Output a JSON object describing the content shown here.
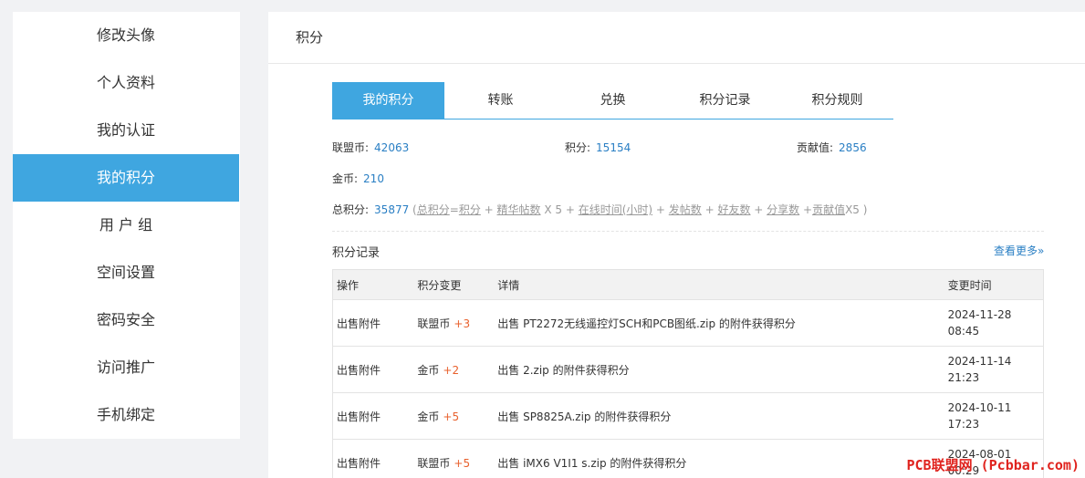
{
  "sidebar": {
    "items": [
      {
        "label": "修改头像"
      },
      {
        "label": "个人资料"
      },
      {
        "label": "我的认证"
      },
      {
        "label": "我的积分"
      },
      {
        "label": "用 户 组"
      },
      {
        "label": "空间设置"
      },
      {
        "label": "密码安全"
      },
      {
        "label": "访问推广"
      },
      {
        "label": "手机绑定"
      }
    ]
  },
  "header": {
    "title": "积分"
  },
  "tabs": [
    {
      "label": "我的积分"
    },
    {
      "label": "转账"
    },
    {
      "label": "兑换"
    },
    {
      "label": "积分记录"
    },
    {
      "label": "积分规则"
    }
  ],
  "stats": {
    "lianmengbi_label": "联盟币:",
    "lianmengbi_value": "42063",
    "jifen_label": "积分:",
    "jifen_value": "15154",
    "gongxian_label": "贡献值:",
    "gongxian_value": "2856",
    "jinbi_label": "金币:",
    "jinbi_value": "210"
  },
  "formula": {
    "label": "总积分:",
    "value": "35877",
    "open": " (",
    "total_link": "总积分",
    "eq": "=",
    "jifen_link": "积分",
    "plus1": " + ",
    "jinghua_link": "精华帖数",
    "x5": " X 5 + ",
    "online_link": "在线时间(小时)",
    "plus2": " + ",
    "fatie_link": "发帖数",
    "plus3": " + ",
    "haoyou_link": "好友数",
    "plus4": " + ",
    "fenxiang_link": "分享数",
    "plus5": " +",
    "gongxian_link": "贡献值",
    "tail": "X5 )"
  },
  "records": {
    "title": "积分记录",
    "more": "查看更多»",
    "headers": [
      "操作",
      "积分变更",
      "详情",
      "变更时间"
    ],
    "rows": [
      {
        "action": "出售附件",
        "currency": "联盟币",
        "delta": "+3",
        "detail": "出售 PT2272无线遥控灯SCH和PCB图纸.zip 的附件获得积分",
        "date": "2024-11-28",
        "time": "08:45"
      },
      {
        "action": "出售附件",
        "currency": "金币",
        "delta": "+2",
        "detail": "出售 2.zip 的附件获得积分",
        "date": "2024-11-14",
        "time": "21:23"
      },
      {
        "action": "出售附件",
        "currency": "金币",
        "delta": "+5",
        "detail": "出售 SP8825A.zip 的附件获得积分",
        "date": "2024-10-11",
        "time": "17:23"
      },
      {
        "action": "出售附件",
        "currency": "联盟币",
        "delta": "+5",
        "detail": "出售 iMX6 V1I1 s.zip 的附件获得积分",
        "date": "2024-08-01",
        "time": "00:29"
      }
    ]
  },
  "watermark": "PCB联盟网 (Pcbbar.com)",
  "colors": {
    "accent": "#3fa6e0",
    "link": "#2a7fc4",
    "delta": "#e8602c",
    "watermark": "#e0241f"
  }
}
